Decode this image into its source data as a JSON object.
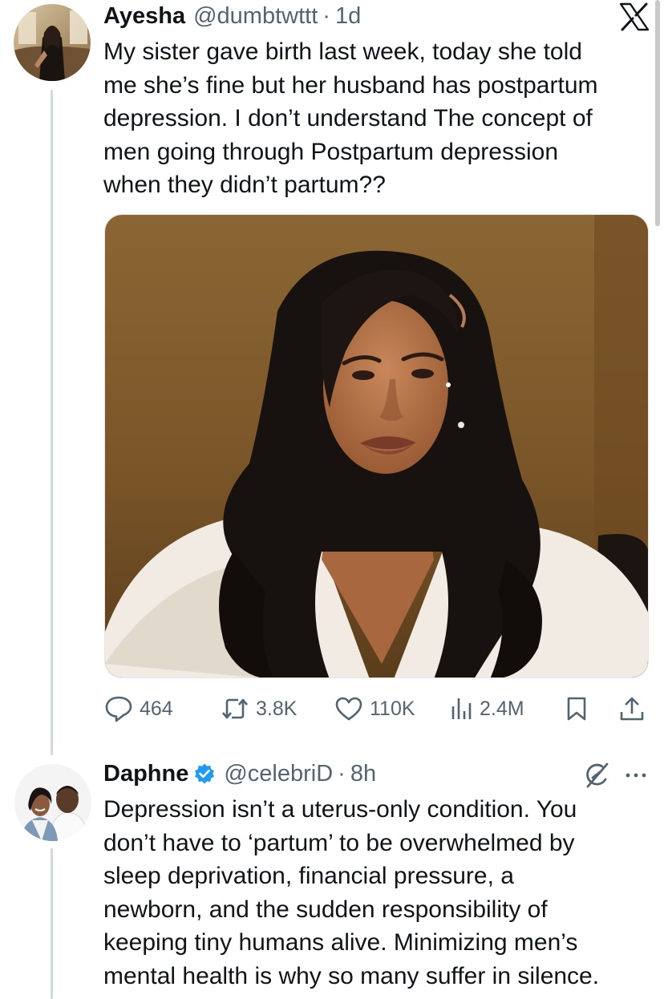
{
  "tweet1": {
    "name": "Ayesha",
    "handle": "@dumbtwttt",
    "separator": "·",
    "time": "1d",
    "lines": [
      "My sister gave birth last week, today she told",
      "me she’s fine but her husband has postpartum",
      "depression. I don’t understand The concept of",
      "men going through Postpartum depression",
      "when they didn’t partum??"
    ],
    "stats": {
      "replies": "464",
      "retweets": "3.8K",
      "likes": "110K",
      "views": "2.4M"
    }
  },
  "tweet2": {
    "name": "Daphne",
    "handle": "@celebriD",
    "separator": "·",
    "time": "8h",
    "lines": [
      "Depression isn’t a uterus-only condition. You",
      "don’t have to ‘partum’ to be overwhelmed by",
      "sleep deprivation, financial pressure, a",
      "newborn, and the sudden responsibility of",
      "keeping tiny humans alive. Minimizing men’s",
      "mental health is why so many suffer in silence."
    ]
  },
  "colors": {
    "text": "#0f1419",
    "secondary": "#536471",
    "verified": "#1d9bf0",
    "thread_line": "#cfd9de"
  },
  "icons": {
    "app_logo": "x-logo-icon",
    "reply": "reply-icon",
    "retweet": "retweet-icon",
    "like": "heart-icon",
    "views": "views-icon",
    "bookmark": "bookmark-icon",
    "share": "share-icon",
    "grok": "grok-icon",
    "more": "more-icon",
    "verified": "verified-badge-icon"
  }
}
